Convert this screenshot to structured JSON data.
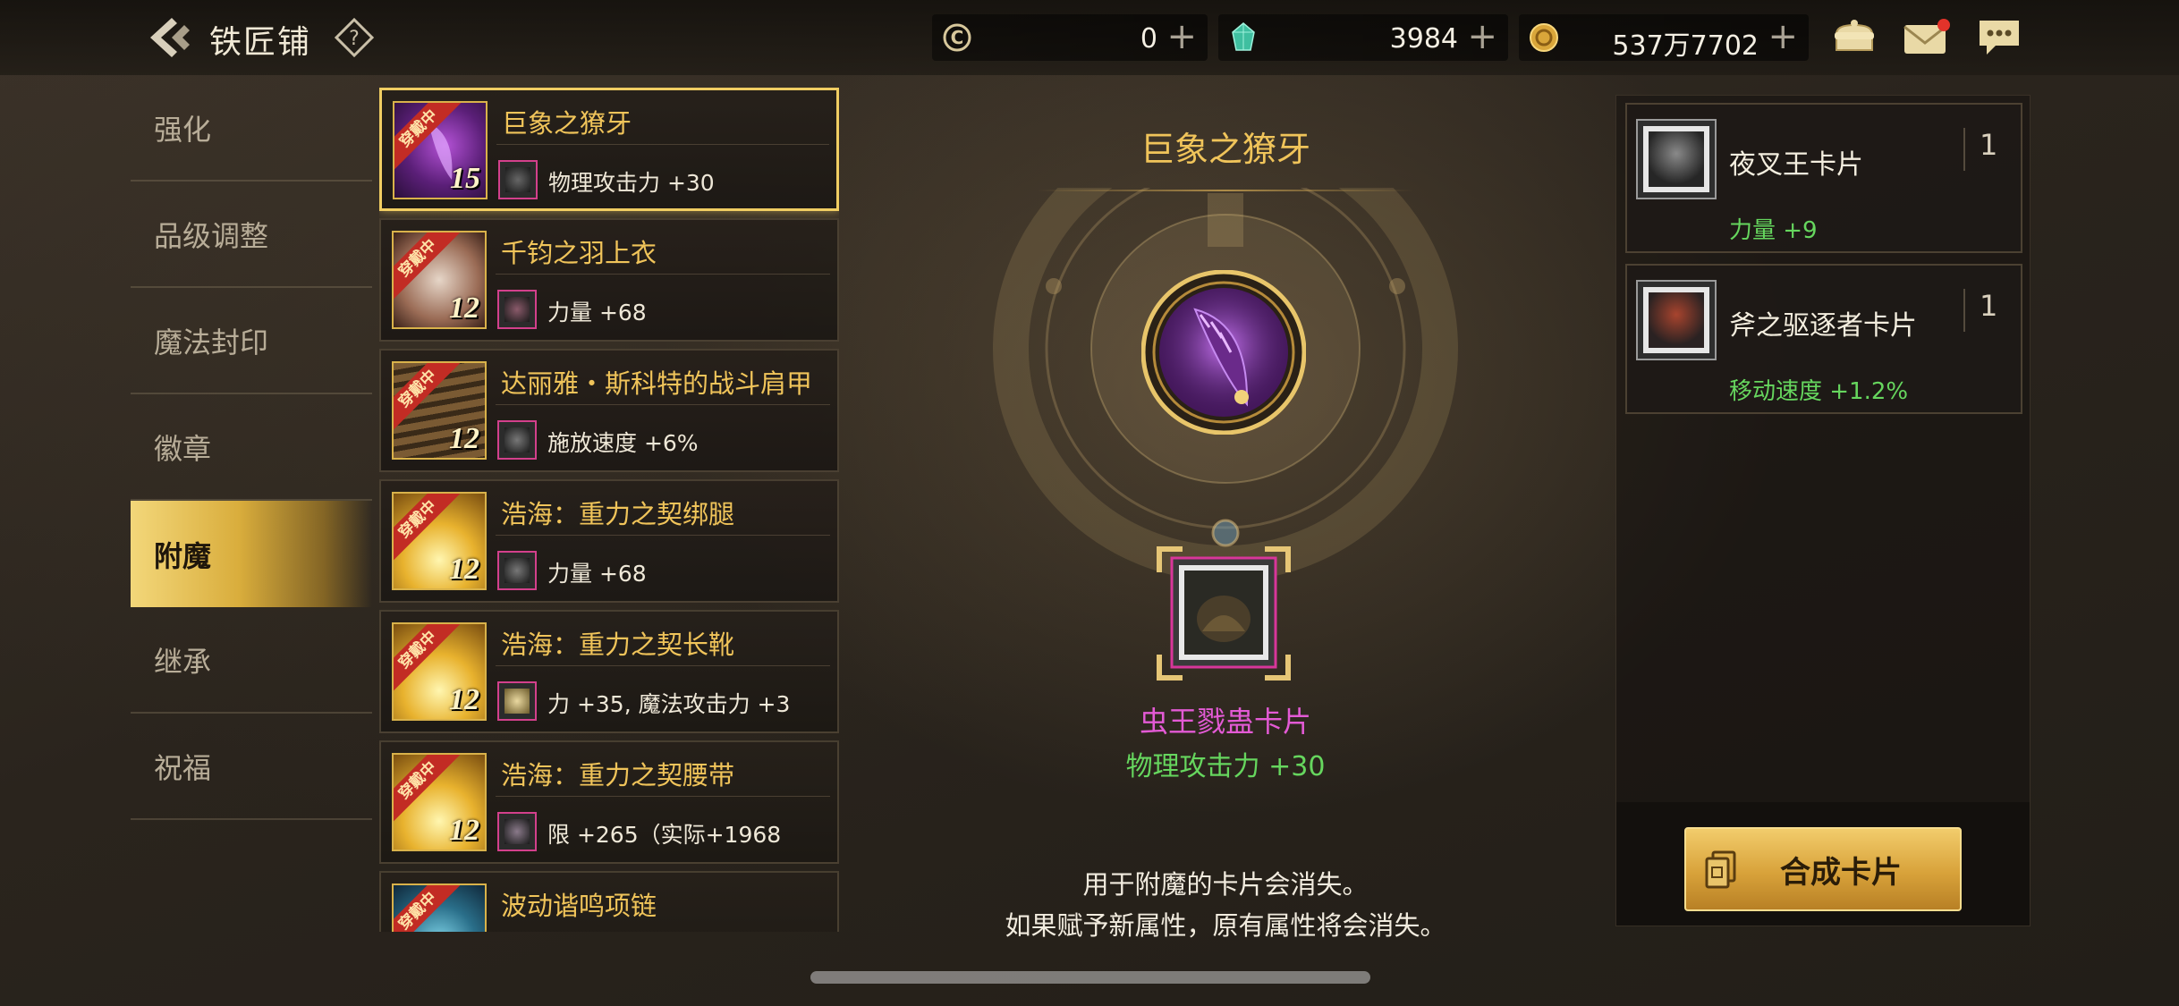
{
  "header": {
    "title": "铁匠铺",
    "help_label": "?"
  },
  "currencies": [
    {
      "icon": "c-coin-icon",
      "value": "0"
    },
    {
      "icon": "green-crystal-icon",
      "value": "3984"
    },
    {
      "icon": "gold-coin-icon",
      "value": "537万7702"
    }
  ],
  "nav": {
    "items": [
      {
        "label": "强化"
      },
      {
        "label": "品级调整"
      },
      {
        "label": "魔法封印"
      },
      {
        "label": "徽章"
      },
      {
        "label": "附魔",
        "active": true
      },
      {
        "label": "继承"
      },
      {
        "label": "祝福"
      }
    ]
  },
  "equipment": [
    {
      "name": "巨象之獠牙",
      "level": "15",
      "badge": "穿戴中",
      "stat": "物理攻击力 +30",
      "selected": true
    },
    {
      "name": "千钧之羽上衣",
      "level": "12",
      "badge": "穿戴中",
      "stat": "力量 +68"
    },
    {
      "name": "达丽雅・斯科特的战斗肩甲",
      "level": "12",
      "badge": "穿戴中",
      "stat": "施放速度 +6%"
    },
    {
      "name": "浩海：重力之契绑腿",
      "level": "12",
      "badge": "穿戴中",
      "stat": "力量 +68"
    },
    {
      "name": "浩海：重力之契长靴",
      "level": "12",
      "badge": "穿戴中",
      "stat": "力 +35, 魔法攻击力 +3"
    },
    {
      "name": "浩海：重力之契腰带",
      "level": "12",
      "badge": "穿戴中",
      "stat": "限 +265（实际+1968"
    },
    {
      "name": "波动谐鸣项链",
      "level": "",
      "badge": "穿戴中",
      "stat": ""
    }
  ],
  "detail": {
    "item_name": "巨象之獠牙",
    "card_name": "虫王戮蛊卡片",
    "card_stat": "物理攻击力 +30",
    "notice_line1": "用于附魔的卡片会消失。",
    "notice_line2": "如果赋予新属性，原有属性将会消失。"
  },
  "cards": [
    {
      "name": "夜叉王卡片",
      "count": "1",
      "stat": "力量 +9"
    },
    {
      "name": "斧之驱逐者卡片",
      "count": "1",
      "stat": "移动速度 +1.2%"
    }
  ],
  "actions": {
    "synthesize_label": "合成卡片"
  },
  "colors": {
    "accent_gold": "#f0c45a",
    "card_pink": "#e35ad5",
    "stat_green": "#66d65e",
    "wearing_red": "#c22c24"
  }
}
